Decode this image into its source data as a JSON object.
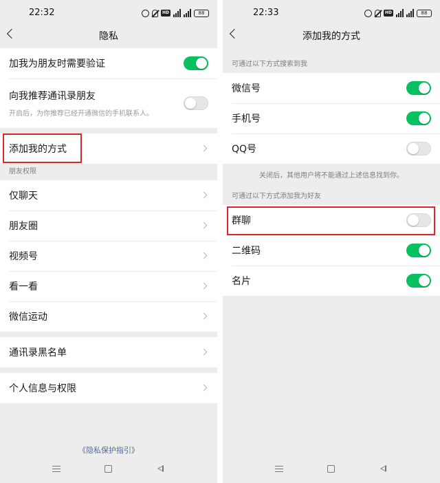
{
  "left": {
    "status": {
      "time": "22:32",
      "battery": "88"
    },
    "title": "隐私",
    "verify_friend": {
      "label": "加我为朋友时需要验证",
      "on": true
    },
    "recommend_contacts": {
      "label": "向我推荐通讯录朋友",
      "sub": "开启后，为你推荐已经开通微信的手机联系人。",
      "on": false
    },
    "add_methods": {
      "label": "添加我的方式"
    },
    "friend_permissions": {
      "title": "朋友权限",
      "items": [
        {
          "label": "仅聊天"
        },
        {
          "label": "朋友圈"
        },
        {
          "label": "视频号"
        },
        {
          "label": "看一看"
        },
        {
          "label": "微信运动"
        }
      ]
    },
    "blacklist": {
      "label": "通讯录黑名单"
    },
    "personal_info": {
      "label": "个人信息与权限"
    },
    "privacy_guide": "《隐私保护指引》"
  },
  "right": {
    "status": {
      "time": "22:33",
      "battery": "88"
    },
    "title": "添加我的方式",
    "search_section": {
      "title": "可通过以下方式搜索到我",
      "items": [
        {
          "label": "微信号",
          "on": true
        },
        {
          "label": "手机号",
          "on": true
        },
        {
          "label": "QQ号",
          "on": false
        }
      ],
      "footnote": "关闭后，其他用户将不能通过上述信息找到你。"
    },
    "add_section": {
      "title": "可通过以下方式添加我为好友",
      "items": [
        {
          "label": "群聊",
          "on": false
        },
        {
          "label": "二维码",
          "on": true
        },
        {
          "label": "名片",
          "on": true
        }
      ]
    }
  },
  "colors": {
    "accent": "#07c160",
    "highlight": "#e0242b",
    "link": "#576b95",
    "background": "#ededed"
  }
}
